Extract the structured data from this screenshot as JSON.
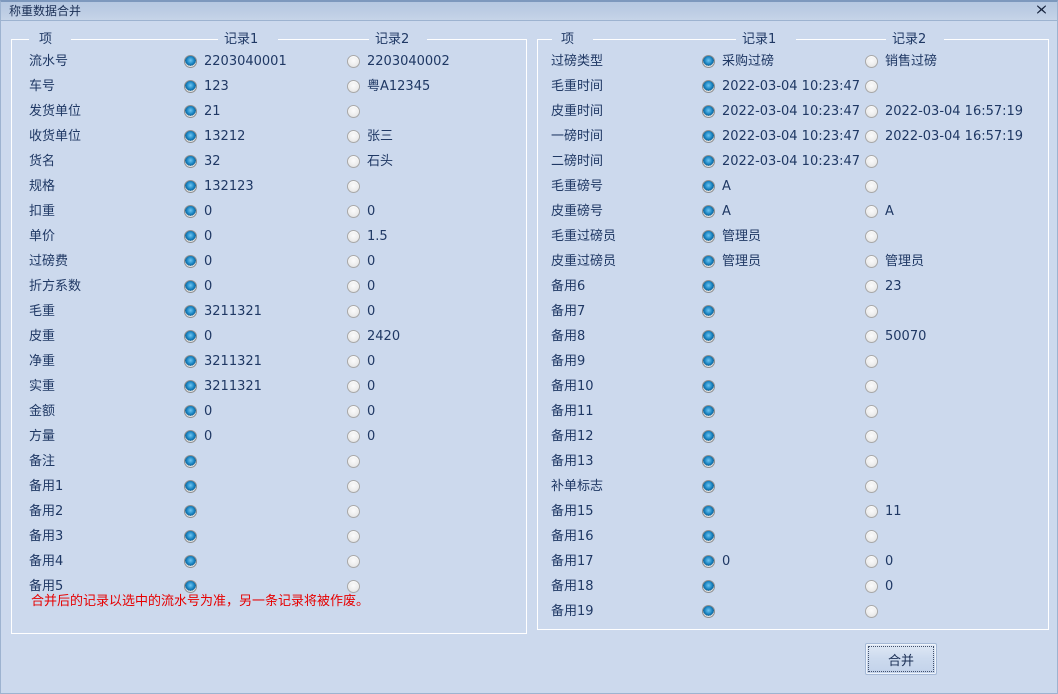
{
  "window": {
    "title": "称重数据合并",
    "close_icon": "close-icon",
    "close_glyph": "✖"
  },
  "colors": {
    "background": "#ccd9ed",
    "titlebar": "#bdcde4",
    "text": "#1f3864",
    "warning": "#e60000",
    "radio_selected": "#1b86c4"
  },
  "left_panel": {
    "headers": {
      "item": "项",
      "record1": "记录1",
      "record2": "记录2"
    },
    "rows": [
      {
        "label": "流水号",
        "r1": {
          "selected": true,
          "value": "2203040001"
        },
        "r2": {
          "selected": false,
          "value": "2203040002"
        }
      },
      {
        "label": "车号",
        "r1": {
          "selected": true,
          "value": "123"
        },
        "r2": {
          "selected": false,
          "value": "粤A12345"
        }
      },
      {
        "label": "发货单位",
        "r1": {
          "selected": true,
          "value": "21"
        },
        "r2": {
          "selected": false,
          "value": ""
        }
      },
      {
        "label": "收货单位",
        "r1": {
          "selected": true,
          "value": "13212"
        },
        "r2": {
          "selected": false,
          "value": "张三"
        }
      },
      {
        "label": "货名",
        "r1": {
          "selected": true,
          "value": "32"
        },
        "r2": {
          "selected": false,
          "value": "石头"
        }
      },
      {
        "label": "规格",
        "r1": {
          "selected": true,
          "value": "132123"
        },
        "r2": {
          "selected": false,
          "value": ""
        }
      },
      {
        "label": "扣重",
        "r1": {
          "selected": true,
          "value": "0"
        },
        "r2": {
          "selected": false,
          "value": "0"
        }
      },
      {
        "label": "单价",
        "r1": {
          "selected": true,
          "value": "0"
        },
        "r2": {
          "selected": false,
          "value": "1.5"
        }
      },
      {
        "label": "过磅费",
        "r1": {
          "selected": true,
          "value": "0"
        },
        "r2": {
          "selected": false,
          "value": "0"
        }
      },
      {
        "label": "折方系数",
        "r1": {
          "selected": true,
          "value": "0"
        },
        "r2": {
          "selected": false,
          "value": "0"
        }
      },
      {
        "label": "毛重",
        "r1": {
          "selected": true,
          "value": "3211321"
        },
        "r2": {
          "selected": false,
          "value": "0"
        }
      },
      {
        "label": "皮重",
        "r1": {
          "selected": true,
          "value": "0"
        },
        "r2": {
          "selected": false,
          "value": "2420"
        }
      },
      {
        "label": "净重",
        "r1": {
          "selected": true,
          "value": "3211321"
        },
        "r2": {
          "selected": false,
          "value": "0"
        }
      },
      {
        "label": "实重",
        "r1": {
          "selected": true,
          "value": "3211321"
        },
        "r2": {
          "selected": false,
          "value": "0"
        }
      },
      {
        "label": "金额",
        "r1": {
          "selected": true,
          "value": "0"
        },
        "r2": {
          "selected": false,
          "value": "0"
        }
      },
      {
        "label": "方量",
        "r1": {
          "selected": true,
          "value": "0"
        },
        "r2": {
          "selected": false,
          "value": "0"
        }
      },
      {
        "label": "备注",
        "r1": {
          "selected": true,
          "value": ""
        },
        "r2": {
          "selected": false,
          "value": ""
        }
      },
      {
        "label": "备用1",
        "r1": {
          "selected": true,
          "value": ""
        },
        "r2": {
          "selected": false,
          "value": ""
        }
      },
      {
        "label": "备用2",
        "r1": {
          "selected": true,
          "value": ""
        },
        "r2": {
          "selected": false,
          "value": ""
        }
      },
      {
        "label": "备用3",
        "r1": {
          "selected": true,
          "value": ""
        },
        "r2": {
          "selected": false,
          "value": ""
        }
      },
      {
        "label": "备用4",
        "r1": {
          "selected": true,
          "value": ""
        },
        "r2": {
          "selected": false,
          "value": ""
        }
      },
      {
        "label": "备用5",
        "r1": {
          "selected": true,
          "value": ""
        },
        "r2": {
          "selected": false,
          "value": ""
        }
      }
    ],
    "warning": "合并后的记录以选中的流水号为准，另一条记录将被作废。"
  },
  "right_panel": {
    "headers": {
      "item": "项",
      "record1": "记录1",
      "record2": "记录2"
    },
    "rows": [
      {
        "label": "过磅类型",
        "r1": {
          "selected": true,
          "value": "采购过磅"
        },
        "r2": {
          "selected": false,
          "value": "销售过磅"
        }
      },
      {
        "label": "毛重时间",
        "r1": {
          "selected": true,
          "value": "2022-03-04 10:23:47"
        },
        "r2": {
          "selected": false,
          "value": ""
        }
      },
      {
        "label": "皮重时间",
        "r1": {
          "selected": true,
          "value": "2022-03-04 10:23:47"
        },
        "r2": {
          "selected": false,
          "value": "2022-03-04 16:57:19"
        }
      },
      {
        "label": "一磅时间",
        "r1": {
          "selected": true,
          "value": "2022-03-04 10:23:47"
        },
        "r2": {
          "selected": false,
          "value": "2022-03-04 16:57:19"
        }
      },
      {
        "label": "二磅时间",
        "r1": {
          "selected": true,
          "value": "2022-03-04 10:23:47"
        },
        "r2": {
          "selected": false,
          "value": ""
        }
      },
      {
        "label": "毛重磅号",
        "r1": {
          "selected": true,
          "value": "A"
        },
        "r2": {
          "selected": false,
          "value": ""
        }
      },
      {
        "label": "皮重磅号",
        "r1": {
          "selected": true,
          "value": "A"
        },
        "r2": {
          "selected": false,
          "value": "A"
        }
      },
      {
        "label": "毛重过磅员",
        "r1": {
          "selected": true,
          "value": "管理员"
        },
        "r2": {
          "selected": false,
          "value": ""
        }
      },
      {
        "label": "皮重过磅员",
        "r1": {
          "selected": true,
          "value": "管理员"
        },
        "r2": {
          "selected": false,
          "value": "管理员"
        }
      },
      {
        "label": "备用6",
        "r1": {
          "selected": true,
          "value": ""
        },
        "r2": {
          "selected": false,
          "value": "23"
        }
      },
      {
        "label": "备用7",
        "r1": {
          "selected": true,
          "value": ""
        },
        "r2": {
          "selected": false,
          "value": ""
        }
      },
      {
        "label": "备用8",
        "r1": {
          "selected": true,
          "value": ""
        },
        "r2": {
          "selected": false,
          "value": "50070"
        }
      },
      {
        "label": "备用9",
        "r1": {
          "selected": true,
          "value": ""
        },
        "r2": {
          "selected": false,
          "value": ""
        }
      },
      {
        "label": "备用10",
        "r1": {
          "selected": true,
          "value": ""
        },
        "r2": {
          "selected": false,
          "value": ""
        }
      },
      {
        "label": "备用11",
        "r1": {
          "selected": true,
          "value": ""
        },
        "r2": {
          "selected": false,
          "value": ""
        }
      },
      {
        "label": "备用12",
        "r1": {
          "selected": true,
          "value": ""
        },
        "r2": {
          "selected": false,
          "value": ""
        }
      },
      {
        "label": "备用13",
        "r1": {
          "selected": true,
          "value": ""
        },
        "r2": {
          "selected": false,
          "value": ""
        }
      },
      {
        "label": "补单标志",
        "r1": {
          "selected": true,
          "value": ""
        },
        "r2": {
          "selected": false,
          "value": ""
        }
      },
      {
        "label": "备用15",
        "r1": {
          "selected": true,
          "value": ""
        },
        "r2": {
          "selected": false,
          "value": "11"
        }
      },
      {
        "label": "备用16",
        "r1": {
          "selected": true,
          "value": ""
        },
        "r2": {
          "selected": false,
          "value": ""
        }
      },
      {
        "label": "备用17",
        "r1": {
          "selected": true,
          "value": "0"
        },
        "r2": {
          "selected": false,
          "value": "0"
        }
      },
      {
        "label": "备用18",
        "r1": {
          "selected": true,
          "value": ""
        },
        "r2": {
          "selected": false,
          "value": "0"
        }
      },
      {
        "label": "备用19",
        "r1": {
          "selected": true,
          "value": ""
        },
        "r2": {
          "selected": false,
          "value": ""
        }
      }
    ]
  },
  "footer": {
    "merge_label": "合并"
  }
}
